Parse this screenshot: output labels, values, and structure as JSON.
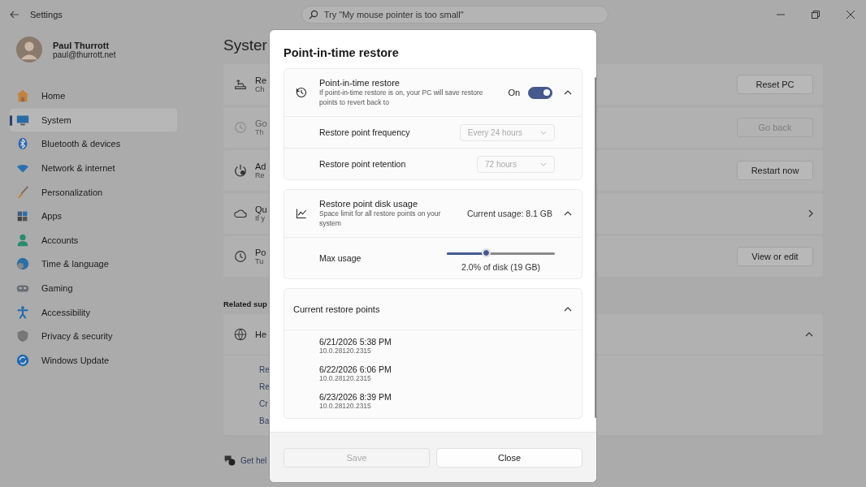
{
  "window": {
    "title": "Settings",
    "search": {
      "placeholder": "Try \"My mouse pointer is too small\""
    }
  },
  "profile": {
    "name": "Paul Thurrott",
    "email": "paul@thurrott.net"
  },
  "sidebar": {
    "items": [
      {
        "label": "Home",
        "selected": false
      },
      {
        "label": "System",
        "selected": true
      },
      {
        "label": "Bluetooth & devices",
        "selected": false
      },
      {
        "label": "Network & internet",
        "selected": false
      },
      {
        "label": "Personalization",
        "selected": false
      },
      {
        "label": "Apps",
        "selected": false
      },
      {
        "label": "Accounts",
        "selected": false
      },
      {
        "label": "Time & language",
        "selected": false
      },
      {
        "label": "Gaming",
        "selected": false
      },
      {
        "label": "Accessibility",
        "selected": false
      },
      {
        "label": "Privacy & security",
        "selected": false
      },
      {
        "label": "Windows Update",
        "selected": false
      }
    ]
  },
  "page": {
    "title": "Syster",
    "cards": [
      {
        "title": "Re",
        "subtitle": "Ch",
        "disabled": false,
        "action": {
          "kind": "button",
          "label": "Reset PC",
          "disabled": false
        }
      },
      {
        "title": "Go",
        "subtitle": "Th",
        "disabled": true,
        "action": {
          "kind": "button",
          "label": "Go back",
          "disabled": true
        }
      },
      {
        "title": "Ad",
        "subtitle": "Re",
        "disabled": false,
        "action": {
          "kind": "button",
          "label": "Restart now",
          "disabled": false
        }
      },
      {
        "title": "Qu",
        "subtitle": "If y",
        "disabled": false,
        "action": {
          "kind": "chevron"
        }
      },
      {
        "title": "Po",
        "subtitle": "Tu",
        "disabled": false,
        "action": {
          "kind": "button",
          "label": "View or edit",
          "disabled": false
        }
      }
    ]
  },
  "related": {
    "heading": "Related sup",
    "card": {
      "title": "He",
      "expanded": true,
      "links": [
        "Re",
        "Re",
        "Cr",
        "Ba"
      ]
    },
    "get_help": "Get hel"
  },
  "dialog": {
    "title": "Point-in-time restore",
    "restore": {
      "title": "Point-in-time restore",
      "description": "If point-in-time restore is on, your PC will save restore points to revert back to",
      "state_label": "On",
      "on": true,
      "expanded": true,
      "settings": [
        {
          "label": "Restore point frequency",
          "value": "Every 24 hours",
          "disabled": true
        },
        {
          "label": "Restore point retention",
          "value": "72 hours",
          "disabled": true
        }
      ]
    },
    "disk": {
      "title": "Restore point disk usage",
      "description": "Space limit for all restore points on your system",
      "usage": "Current usage: 8.1 GB",
      "expanded": true,
      "max_label": "Max usage",
      "level": 0.37,
      "reading": "2.0% of disk (19 GB)"
    },
    "points": {
      "title": "Current restore points",
      "expanded": true,
      "items": [
        {
          "date": "6/21/2026 5:38 PM",
          "build": "10.0.28120.2315"
        },
        {
          "date": "6/22/2026 6:06 PM",
          "build": "10.0.28120.2315"
        },
        {
          "date": "6/23/2026 8:39 PM",
          "build": "10.0.28120.2315"
        }
      ]
    },
    "buttons": [
      {
        "label": "Save",
        "disabled": true
      },
      {
        "label": "Close",
        "disabled": false
      }
    ]
  }
}
